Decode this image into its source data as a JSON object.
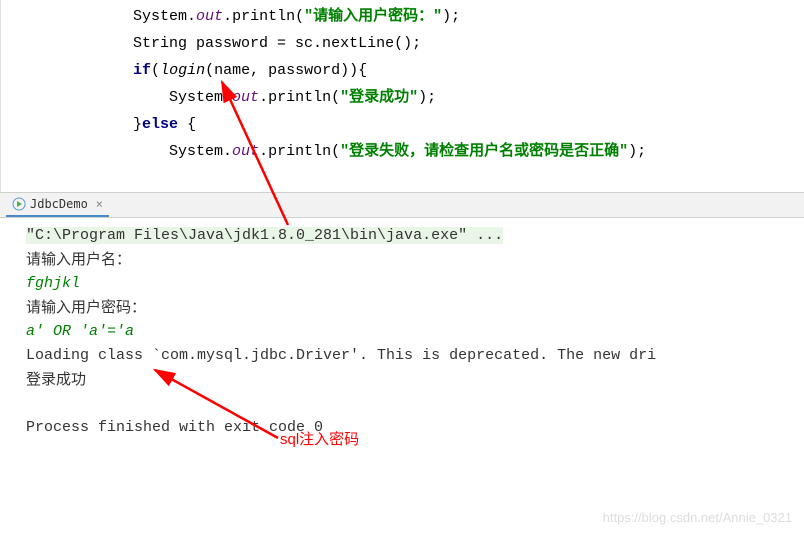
{
  "editor": {
    "gutter": [
      "",
      "",
      "",
      "",
      "",
      "",
      ""
    ],
    "lines": [
      {
        "indent": "            ",
        "segments": [
          {
            "t": "System.",
            "c": ""
          },
          {
            "t": "out",
            "c": "field"
          },
          {
            "t": ".println(",
            "c": ""
          },
          {
            "t": "\"请输入用户密码：\"",
            "c": "str"
          },
          {
            "t": ");",
            "c": ""
          }
        ]
      },
      {
        "indent": "            ",
        "segments": [
          {
            "t": "String password = sc.nextLine();",
            "c": ""
          }
        ]
      },
      {
        "indent": "            ",
        "segments": [
          {
            "t": "if",
            "c": "kw"
          },
          {
            "t": "(",
            "c": ""
          },
          {
            "t": "login",
            "c": "method"
          },
          {
            "t": "(name, password)){",
            "c": ""
          }
        ]
      },
      {
        "indent": "                ",
        "segments": [
          {
            "t": "System.",
            "c": ""
          },
          {
            "t": "out",
            "c": "field"
          },
          {
            "t": ".println(",
            "c": ""
          },
          {
            "t": "\"登录成功\"",
            "c": "str"
          },
          {
            "t": ");",
            "c": ""
          }
        ]
      },
      {
        "indent": "            ",
        "segments": [
          {
            "t": "}",
            "c": ""
          },
          {
            "t": "else ",
            "c": "kw"
          },
          {
            "t": "{",
            "c": ""
          }
        ]
      },
      {
        "indent": "                ",
        "segments": [
          {
            "t": "System.",
            "c": ""
          },
          {
            "t": "out",
            "c": "field"
          },
          {
            "t": ".println(",
            "c": ""
          },
          {
            "t": "\"登录失败，请检查用户名或密码是否正确\"",
            "c": "str"
          },
          {
            "t": ");",
            "c": ""
          }
        ]
      },
      {
        "indent": "            ",
        "segments": []
      }
    ]
  },
  "tab": {
    "label": "JdbcDemo"
  },
  "console": {
    "path": "\"C:\\Program Files\\Java\\jdk1.8.0_281\\bin\\java.exe\" ...",
    "l1": "请输入用户名：",
    "in1": "fghjkl",
    "l2": "请输入用户密码：",
    "in2": "a' OR 'a'='a",
    "warn": "Loading class `com.mysql.jdbc.Driver'. This is deprecated. The new dri",
    "l3": "登录成功",
    "exit": "Process finished with exit code 0"
  },
  "annotation": {
    "text": "sql注入密码"
  },
  "watermark": "https://blog.csdn.net/Annie_0321"
}
